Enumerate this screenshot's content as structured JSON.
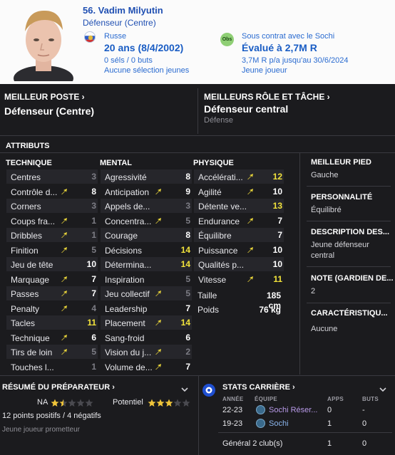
{
  "header": {
    "name": "56. Vadim Milyutin",
    "position": "Défenseur (Centre)",
    "nationality": "Russe",
    "age": "20 ans (8/4/2002)",
    "caps": "0 séls / 0 buts",
    "youth_caps": "Aucune sélection jeunes",
    "club_badge_text": "Obs",
    "contract": "Sous contrat avec le Sochi",
    "value": "Évalué à 2,7M R",
    "wage": "3,7M R p/a jusqu'au 30/6/2024",
    "status": "Jeune joueur"
  },
  "best_position": {
    "title": "MEILLEUR POSTE",
    "value": "Défenseur (Centre)"
  },
  "best_role": {
    "title": "MEILLEURS RÔLE ET TÂCHE",
    "value": "Défenseur central",
    "sub": "Défense"
  },
  "attributes": {
    "title": "ATTRIBUTS",
    "technique": {
      "header": "TECHNIQUE",
      "rows": [
        {
          "name": "Centres",
          "value": "3",
          "tone": "grey",
          "arrow": false
        },
        {
          "name": "Contrôle d...",
          "value": "8",
          "tone": "white",
          "arrow": true
        },
        {
          "name": "Corners",
          "value": "3",
          "tone": "grey",
          "arrow": false
        },
        {
          "name": "Coups fra...",
          "value": "1",
          "tone": "grey",
          "arrow": true
        },
        {
          "name": "Dribbles",
          "value": "1",
          "tone": "grey",
          "arrow": true
        },
        {
          "name": "Finition",
          "value": "5",
          "tone": "grey",
          "arrow": true
        },
        {
          "name": "Jeu de tête",
          "value": "10",
          "tone": "white",
          "arrow": false
        },
        {
          "name": "Marquage",
          "value": "7",
          "tone": "white",
          "arrow": true
        },
        {
          "name": "Passes",
          "value": "7",
          "tone": "white",
          "arrow": true
        },
        {
          "name": "Penalty",
          "value": "4",
          "tone": "grey",
          "arrow": true
        },
        {
          "name": "Tacles",
          "value": "11",
          "tone": "yellow",
          "arrow": false
        },
        {
          "name": "Technique",
          "value": "6",
          "tone": "white",
          "arrow": true
        },
        {
          "name": "Tirs de loin",
          "value": "5",
          "tone": "grey",
          "arrow": true
        },
        {
          "name": "Touches l...",
          "value": "1",
          "tone": "grey",
          "arrow": false
        }
      ]
    },
    "mental": {
      "header": "MENTAL",
      "rows": [
        {
          "name": "Agressivité",
          "value": "8",
          "tone": "white",
          "arrow": false
        },
        {
          "name": "Anticipation",
          "value": "9",
          "tone": "white",
          "arrow": true
        },
        {
          "name": "Appels de...",
          "value": "3",
          "tone": "grey",
          "arrow": false
        },
        {
          "name": "Concentra...",
          "value": "5",
          "tone": "grey",
          "arrow": true
        },
        {
          "name": "Courage",
          "value": "8",
          "tone": "white",
          "arrow": false
        },
        {
          "name": "Décisions",
          "value": "14",
          "tone": "yellow",
          "arrow": false
        },
        {
          "name": "Détermina...",
          "value": "14",
          "tone": "yellow",
          "arrow": false
        },
        {
          "name": "Inspiration",
          "value": "5",
          "tone": "grey",
          "arrow": false
        },
        {
          "name": "Jeu collectif",
          "value": "5",
          "tone": "grey",
          "arrow": true
        },
        {
          "name": "Leadership",
          "value": "7",
          "tone": "white",
          "arrow": false
        },
        {
          "name": "Placement",
          "value": "14",
          "tone": "yellow",
          "arrow": true
        },
        {
          "name": "Sang-froid",
          "value": "6",
          "tone": "white",
          "arrow": false
        },
        {
          "name": "Vision du j...",
          "value": "2",
          "tone": "grey",
          "arrow": true
        },
        {
          "name": "Volume de...",
          "value": "7",
          "tone": "white",
          "arrow": true
        }
      ]
    },
    "physique": {
      "header": "PHYSIQUE",
      "rows": [
        {
          "name": "Accélérati...",
          "value": "12",
          "tone": "yellow",
          "arrow": true
        },
        {
          "name": "Agilité",
          "value": "10",
          "tone": "white",
          "arrow": true
        },
        {
          "name": "Détente ve...",
          "value": "13",
          "tone": "yellow",
          "arrow": false
        },
        {
          "name": "Endurance",
          "value": "7",
          "tone": "white",
          "arrow": true
        },
        {
          "name": "Équilibre",
          "value": "7",
          "tone": "white",
          "arrow": false
        },
        {
          "name": "Puissance",
          "value": "10",
          "tone": "white",
          "arrow": true
        },
        {
          "name": "Qualités p...",
          "value": "10",
          "tone": "white",
          "arrow": false
        },
        {
          "name": "Vitesse",
          "value": "11",
          "tone": "yellow",
          "arrow": true
        }
      ],
      "height_label": "Taille",
      "height_value": "185 cm",
      "weight_label": "Poids",
      "weight_value": "76 kg"
    }
  },
  "side": {
    "foot_title": "MEILLEUR PIED",
    "foot_value": "Gauche",
    "personality_title": "PERSONNALITÉ",
    "personality_value": "Équilibré",
    "desc_title": "DESCRIPTION DES...",
    "desc_value_1": "Jeune défenseur",
    "desc_value_2": "central",
    "gk_title": "NOTE (GARDIEN DE...",
    "gk_value": "2",
    "traits_title": "CARACTÉRISTIQU...",
    "traits_value": "Aucune"
  },
  "coach": {
    "title": "RÉSUMÉ DU PRÉPARATEUR",
    "na_label": "NA",
    "potential_label": "Potentiel",
    "ca_stars": 1.5,
    "pa_stars": 3,
    "points": "12 points positifs / 4 négatifs",
    "summary": "Jeune joueur prometteur"
  },
  "career": {
    "title": "STATS CARRIÈRE",
    "headers": {
      "year": "ANNÉE",
      "team": "ÉQUIPE",
      "apps": "APPS",
      "goals": "BUTS"
    },
    "rows": [
      {
        "year": "22-23",
        "team": "Sochi Réser...",
        "apps": "0",
        "goals": "-"
      },
      {
        "year": "19-23",
        "team": "Sochi",
        "apps": "1",
        "goals": "0"
      }
    ],
    "total_label": "Général 2 club(s)",
    "total_apps": "1",
    "total_goals": "0"
  },
  "colors": {
    "yellow_value": "#f2e33b",
    "white_value": "#ffffff",
    "grey_value": "#7d7d85",
    "arrow": "#e8d43a",
    "link_blue": "#2a6bd0",
    "club_link": "#b89ae8"
  }
}
